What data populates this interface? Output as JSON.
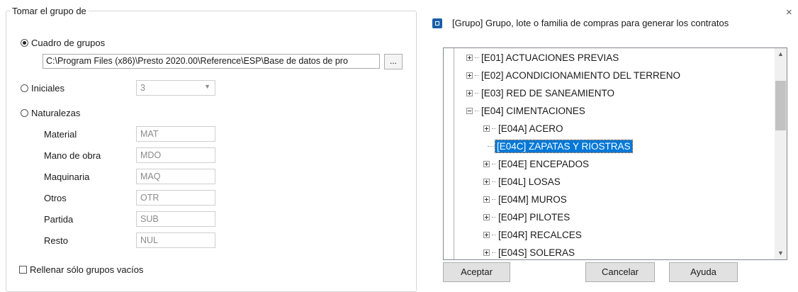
{
  "left_panel": {
    "group_title": "Tomar el grupo de",
    "option_cuadro": "Cuadro de grupos",
    "path_value": "C:\\Program Files (x86)\\Presto 2020.00\\Reference\\ESP\\Base de datos de pro",
    "browse_label": "...",
    "option_iniciales": "Iniciales",
    "iniciales_value": "3",
    "option_naturalezas": "Naturalezas",
    "natures": [
      {
        "label": "Material",
        "value": "MAT"
      },
      {
        "label": "Mano de obra",
        "value": "MDO"
      },
      {
        "label": "Maquinaria",
        "value": "MAQ"
      },
      {
        "label": "Otros",
        "value": "OTR"
      },
      {
        "label": "Partida",
        "value": "SUB"
      },
      {
        "label": "Resto",
        "value": "NUL"
      }
    ],
    "checkbox_label": "Rellenar sólo grupos vacíos"
  },
  "dialog": {
    "title": "[Grupo] Grupo, lote o familia de compras para generar los contratos",
    "close": "×",
    "tree": [
      "[E01] ACTUACIONES PREVIAS",
      "[E02] ACONDICIONAMIENTO DEL TERRENO",
      "[E03] RED DE SANEAMIENTO",
      "[E04] CIMENTACIONES",
      "[E04A] ACERO",
      "[E04C] ZAPATAS Y RIOSTRAS",
      "[E04E] ENCEPADOS",
      "[E04L] LOSAS",
      "[E04M] MUROS",
      "[E04P] PILOTES",
      "[E04R] RECALCES",
      "[E04S] SOLERAS"
    ],
    "buttons": {
      "ok": "Aceptar",
      "cancel": "Cancelar",
      "help": "Ayuda"
    }
  }
}
